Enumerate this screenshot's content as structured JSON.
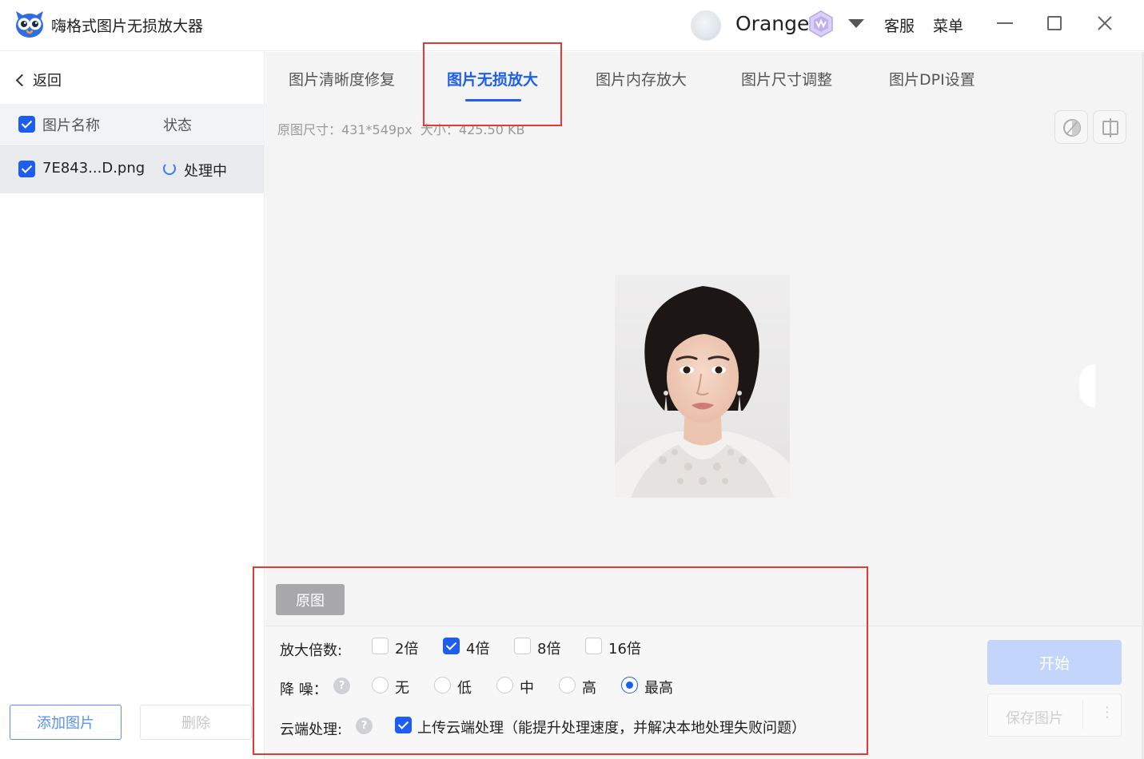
{
  "window": {
    "app_title": "嗨格式图片无损放大器",
    "username": "Orange",
    "customer_service": "客服",
    "menu": "菜单"
  },
  "sidebar": {
    "back_label": "返回",
    "columns": {
      "name": "图片名称",
      "status": "状态"
    },
    "files": [
      {
        "name": "7E843...D.png",
        "status": "处理中",
        "checked": true
      }
    ],
    "add_button": "添加图片",
    "delete_button": "删除"
  },
  "tabs": [
    {
      "label": "图片清晰度修复",
      "active": false
    },
    {
      "label": "图片无损放大",
      "active": true
    },
    {
      "label": "图片内存放大",
      "active": false
    },
    {
      "label": "图片尺寸调整",
      "active": false
    },
    {
      "label": "图片DPI设置",
      "active": false
    }
  ],
  "preview": {
    "info_size": "原图尺寸：431*549px",
    "info_file_size": "大小：425.50 KB",
    "original_button": "原图"
  },
  "options": {
    "scale": {
      "label": "放大倍数:",
      "choices": [
        {
          "label": "2倍",
          "checked": false
        },
        {
          "label": "4倍",
          "checked": true
        },
        {
          "label": "8倍",
          "checked": false
        },
        {
          "label": "16倍",
          "checked": false
        }
      ]
    },
    "denoise": {
      "label": "降 噪：",
      "choices": [
        {
          "label": "无",
          "selected": false
        },
        {
          "label": "低",
          "selected": false
        },
        {
          "label": "中",
          "selected": false
        },
        {
          "label": "高",
          "selected": false
        },
        {
          "label": "最高",
          "selected": true
        }
      ]
    },
    "cloud": {
      "label": "云端处理:",
      "checkbox_label": "上传云端处理（能提升处理速度，并解决本地处理失败问题）",
      "checked": true
    }
  },
  "actions": {
    "start": "开始",
    "save": "保存图片",
    "more": "⋮"
  },
  "colors": {
    "accent": "#1d5ef0",
    "annotation": "#e53935"
  }
}
